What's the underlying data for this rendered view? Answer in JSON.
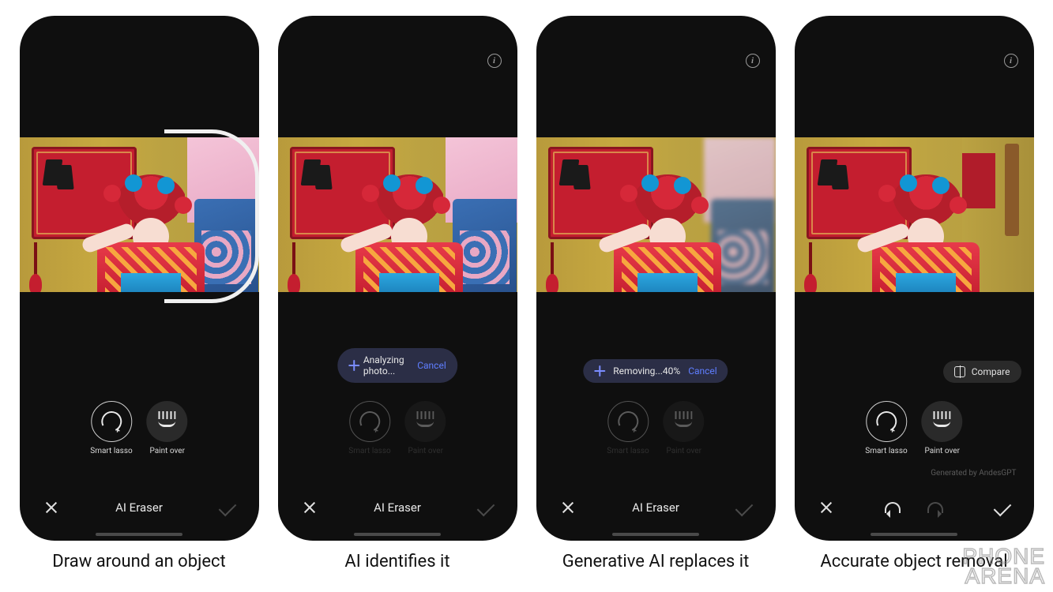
{
  "screens": [
    {
      "caption": "Draw around an object",
      "show_info": false,
      "show_lasso_stroke": true,
      "status_pill": null,
      "compare_button": null,
      "tools_dimmed": false,
      "tools": {
        "smart_lasso": "Smart lasso",
        "paint_over": "Paint over",
        "active": "smart_lasso"
      },
      "photo_state": "original",
      "generated_by": null,
      "bottom": {
        "mode": "title",
        "title": "AI Eraser",
        "check_dim": true
      }
    },
    {
      "caption": "AI identifies it",
      "show_info": true,
      "show_lasso_stroke": false,
      "status_pill": {
        "text": "Analyzing photo...",
        "cancel": "Cancel"
      },
      "compare_button": null,
      "tools_dimmed": true,
      "tools": {
        "smart_lasso": "Smart lasso",
        "paint_over": "Paint over",
        "active": "smart_lasso"
      },
      "photo_state": "original",
      "generated_by": null,
      "bottom": {
        "mode": "title",
        "title": "AI Eraser",
        "check_dim": true
      }
    },
    {
      "caption": "Generative AI replaces it",
      "show_info": true,
      "show_lasso_stroke": false,
      "status_pill": {
        "text": "Removing...40%",
        "cancel": "Cancel"
      },
      "compare_button": null,
      "tools_dimmed": true,
      "tools": {
        "smart_lasso": "Smart lasso",
        "paint_over": "Paint over",
        "active": "smart_lasso"
      },
      "photo_state": "blurred",
      "generated_by": null,
      "bottom": {
        "mode": "title",
        "title": "AI Eraser",
        "check_dim": true
      }
    },
    {
      "caption": "Accurate object removal",
      "show_info": true,
      "show_lasso_stroke": false,
      "status_pill": null,
      "compare_button": {
        "label": "Compare"
      },
      "tools_dimmed": false,
      "tools": {
        "smart_lasso": "Smart lasso",
        "paint_over": "Paint over",
        "active": "smart_lasso"
      },
      "photo_state": "removed",
      "generated_by": "Generated by AndesGPT",
      "bottom": {
        "mode": "undo",
        "check_dim": false,
        "redo_dim": true
      }
    }
  ],
  "watermark": {
    "line1": "PHONE",
    "line2": "ARENA"
  }
}
